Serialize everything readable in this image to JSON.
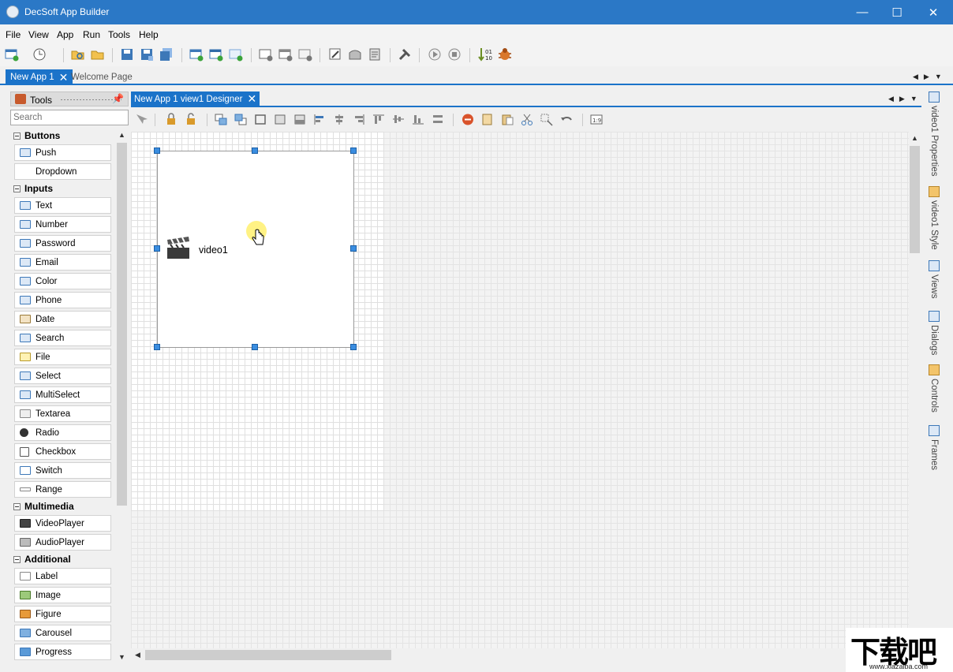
{
  "window": {
    "title": "DecSoft App Builder"
  },
  "menu": [
    "File",
    "View",
    "App",
    "Run",
    "Tools",
    "Help"
  ],
  "doc_tabs": {
    "active": "New App 1",
    "inactive": "Welcome Page"
  },
  "tools_panel": {
    "title": "Tools",
    "search_placeholder": "Search",
    "groups": [
      {
        "name": "Buttons",
        "items": [
          "Push",
          "Dropdown"
        ]
      },
      {
        "name": "Inputs",
        "items": [
          "Text",
          "Number",
          "Password",
          "Email",
          "Color",
          "Phone",
          "Date",
          "Search",
          "File",
          "Select",
          "MultiSelect",
          "Textarea",
          "Radio",
          "Checkbox",
          "Switch",
          "Range"
        ]
      },
      {
        "name": "Multimedia",
        "items": [
          "VideoPlayer",
          "AudioPlayer"
        ]
      },
      {
        "name": "Additional",
        "items": [
          "Label",
          "Image",
          "Figure",
          "Carousel",
          "Progress"
        ]
      }
    ]
  },
  "designer": {
    "tab_label": "New App 1 view1 Designer",
    "control_label": "video1"
  },
  "side_tabs": [
    "video1 Properties",
    "video1 Style",
    "Views",
    "Dialogs",
    "Controls",
    "Frames"
  ],
  "watermark": {
    "big": "下载吧",
    "small": "www.xiazaiba.com"
  },
  "colors": {
    "accent": "#1b73c9",
    "titlebar": "#2b78c6",
    "handle": "#3a8de0"
  }
}
